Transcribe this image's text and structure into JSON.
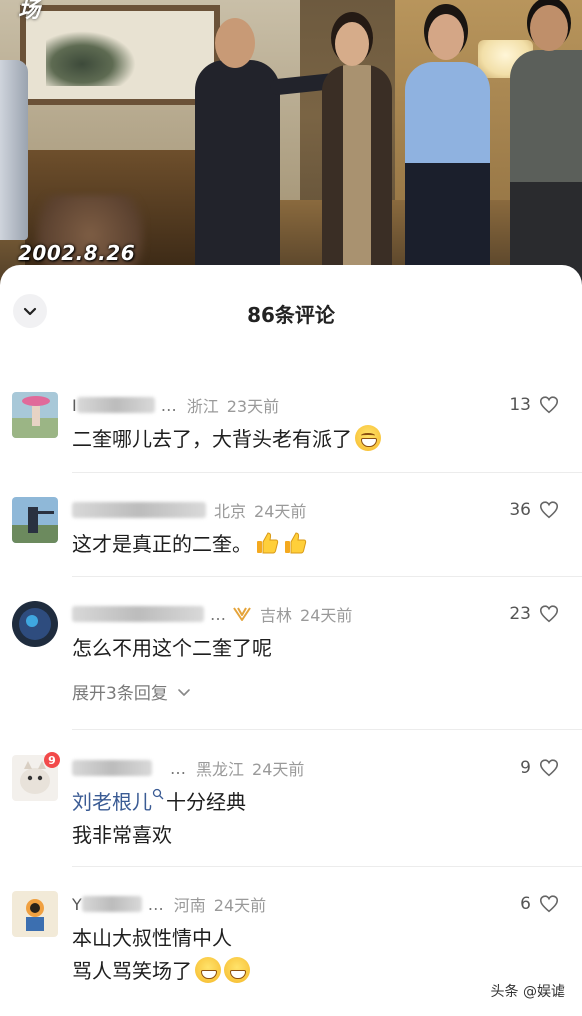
{
  "video": {
    "corner_text": "场",
    "date_stamp": "2002.8.26"
  },
  "sheet": {
    "title": "86条评论"
  },
  "comments": [
    {
      "name": "I",
      "region": "浙江",
      "time": "23天前",
      "likes": "13",
      "lines": [
        "二奎哪儿去了，大背头老有派了"
      ]
    },
    {
      "name": "",
      "region": "北京",
      "time": "24天前",
      "likes": "36",
      "lines": [
        "这才是真正的二奎。"
      ]
    },
    {
      "name": "",
      "region": "吉林",
      "time": "24天前",
      "likes": "23",
      "lines": [
        "怎么不用这个二奎了呢"
      ],
      "expand_label": "展开3条回复"
    },
    {
      "name": "",
      "region": "黑龙江",
      "time": "24天前",
      "likes": "9",
      "badge": "9",
      "mention": "刘老根儿",
      "lines": [
        "十分经典",
        "我非常喜欢"
      ]
    },
    {
      "name": "Y",
      "region": "河南",
      "time": "24天前",
      "likes": "6",
      "lines": [
        "本山大叔性情中人",
        "骂人骂笑场了"
      ]
    }
  ],
  "watermark": "头条 @娱谑",
  "icons": {
    "collapse": "chevron-down-icon",
    "like": "heart-outline-icon",
    "expand": "chevron-down-icon"
  },
  "colors": {
    "mention": "#3a5b94",
    "meta": "#9a9a9a",
    "badge": "#f24a4a"
  }
}
